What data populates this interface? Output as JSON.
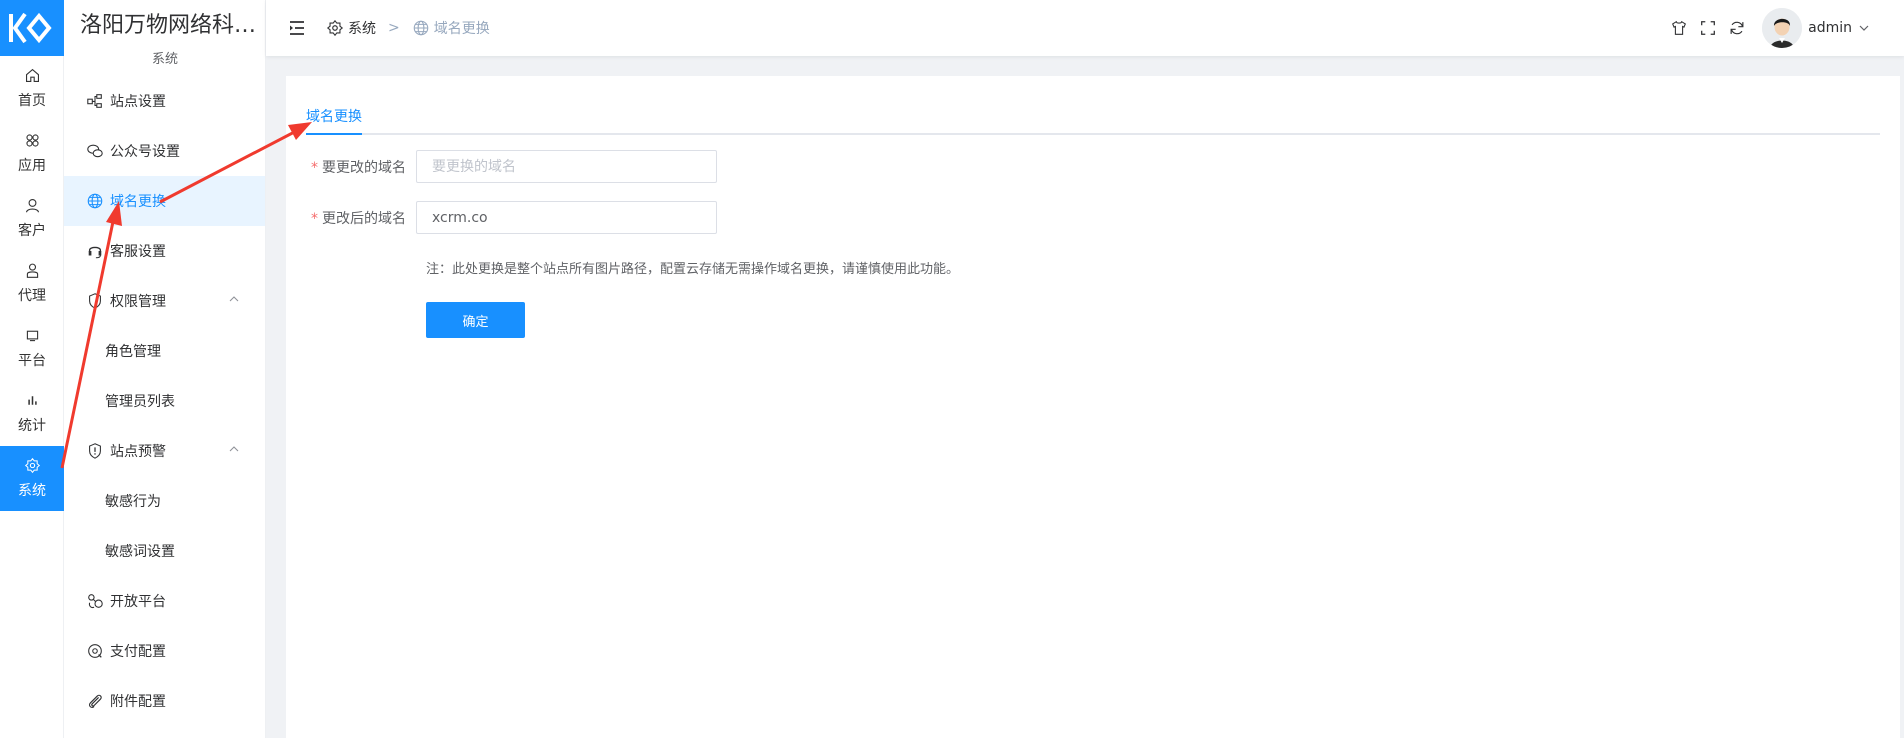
{
  "brand": {
    "name": "洛阳万物网络科技有限公司",
    "subtitle": "系统"
  },
  "rail": [
    {
      "label": "首页",
      "icon": "home-icon"
    },
    {
      "label": "应用",
      "icon": "apps-icon"
    },
    {
      "label": "客户",
      "icon": "user-icon"
    },
    {
      "label": "代理",
      "icon": "agent-icon"
    },
    {
      "label": "平台",
      "icon": "platform-icon"
    },
    {
      "label": "统计",
      "icon": "stats-icon"
    },
    {
      "label": "系统",
      "icon": "gear-icon",
      "active": true
    }
  ],
  "menu": [
    {
      "label": "站点设置",
      "icon": "site-settings-icon"
    },
    {
      "label": "公众号设置",
      "icon": "wechat-icon"
    },
    {
      "label": "域名更换",
      "icon": "globe-icon",
      "active": true
    },
    {
      "label": "客服设置",
      "icon": "headset-icon"
    },
    {
      "label": "权限管理",
      "icon": "shield-icon",
      "expandable": true
    },
    {
      "label": "角色管理",
      "sub": true
    },
    {
      "label": "管理员列表",
      "sub": true
    },
    {
      "label": "站点预警",
      "icon": "warning-shield-icon",
      "expandable": true
    },
    {
      "label": "敏感行为",
      "sub": true
    },
    {
      "label": "敏感词设置",
      "sub": true
    },
    {
      "label": "开放平台",
      "icon": "open-platform-icon"
    },
    {
      "label": "支付配置",
      "icon": "payment-icon"
    },
    {
      "label": "附件配置",
      "icon": "paperclip-icon"
    }
  ],
  "breadcrumb": {
    "root": "系统",
    "separator": ">",
    "current": "域名更换"
  },
  "header": {
    "username": "admin"
  },
  "main": {
    "tab_label": "域名更换",
    "field_old_label": "要更改的域名",
    "field_old_placeholder": "要更换的域名",
    "field_old_value": "",
    "field_new_label": "更改后的域名",
    "field_new_value": "xcrm.co",
    "note": "注：此处更换是整个站点所有图片路径，配置云存储无需操作域名更换，请谨慎使用此功能。",
    "confirm_label": "确定"
  },
  "colors": {
    "accent": "#1890ff",
    "active_bg": "#e8f4ff",
    "annotation_arrow": "#f03a2e",
    "required": "#f56c6c"
  }
}
